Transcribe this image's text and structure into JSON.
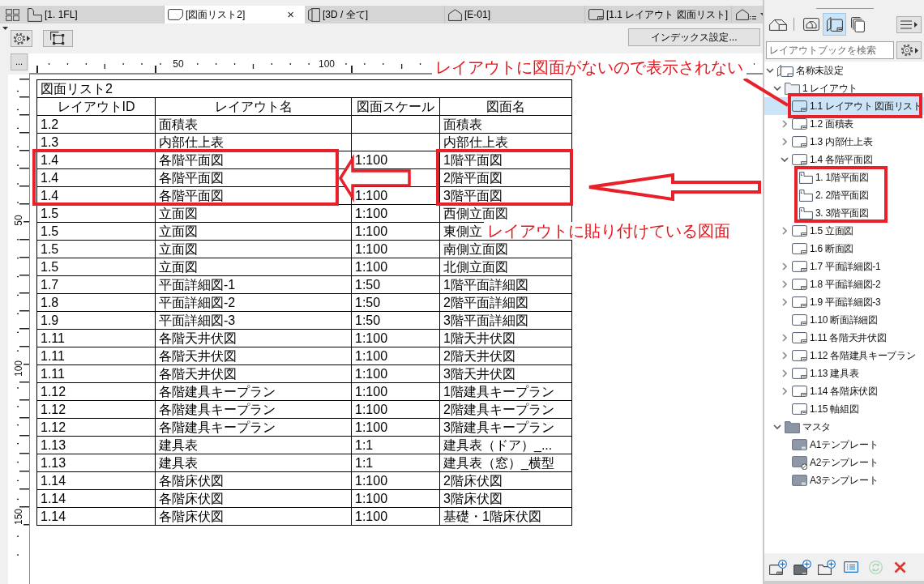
{
  "tab_bar": {
    "tabs": [
      {
        "kind": "plan",
        "label": "[1. 1FL]",
        "selected": false
      },
      {
        "kind": "layout",
        "label": "[図面リスト2]",
        "selected": true,
        "close": "×"
      },
      {
        "kind": "model",
        "label": "[3D / 全て]",
        "selected": false
      },
      {
        "kind": "elevation",
        "label": "[E-01]",
        "selected": false
      },
      {
        "kind": "sheet",
        "label": "[1.1 レイアウト 図面リスト]",
        "selected": false
      }
    ]
  },
  "toolbar": {
    "index_settings_button": "インデックス設定..."
  },
  "ruler": {
    "more_button": "...",
    "horizontal_labels": [
      "50",
      "100"
    ],
    "vertical_labels": [
      "50",
      "100",
      "150"
    ]
  },
  "table": {
    "title": "図面リスト2",
    "columns": [
      "レイアウトID",
      "レイアウト名",
      "図面スケール",
      "図面名"
    ],
    "rows": [
      {
        "layout_id": "1.2",
        "layout_name": "面積表",
        "drawing_name": "面積表"
      },
      {
        "layout_id": "1.3",
        "layout_name": "内部仕上表",
        "drawing_name": "内部仕上表"
      },
      {
        "layout_id": "1.4",
        "layout_name": "各階平面図",
        "drawing_scale": "1:100",
        "drawing_name": "1階平面図"
      },
      {
        "layout_id": "1.4",
        "layout_name": "各階平面図",
        "drawing_name": "2階平面図"
      },
      {
        "layout_id": "1.4",
        "layout_name": "各階平面図",
        "drawing_scale": "1:100",
        "drawing_name": "3階平面図"
      },
      {
        "layout_id": "1.5",
        "layout_name": "立面図",
        "drawing_scale": "1:100",
        "drawing_name": "西側立面図"
      },
      {
        "layout_id": "1.5",
        "layout_name": "立面図",
        "drawing_scale": "1:100",
        "drawing_name": "東側立"
      },
      {
        "layout_id": "1.5",
        "layout_name": "立面図",
        "drawing_scale": "1:100",
        "drawing_name": "南側立面図"
      },
      {
        "layout_id": "1.5",
        "layout_name": "立面図",
        "drawing_scale": "1:100",
        "drawing_name": "北側立面図"
      },
      {
        "layout_id": "1.7",
        "layout_name": "平面詳細図-1",
        "drawing_scale": "1:50",
        "drawing_name": "1階平面詳細図"
      },
      {
        "layout_id": "1.8",
        "layout_name": "平面詳細図-2",
        "drawing_scale": "1:50",
        "drawing_name": "2階平面詳細図"
      },
      {
        "layout_id": "1.9",
        "layout_name": "平面詳細図-3",
        "drawing_scale": "1:50",
        "drawing_name": "3階平面詳細図"
      },
      {
        "layout_id": "1.11",
        "layout_name": "各階天井伏図",
        "drawing_scale": "1:100",
        "drawing_name": "1階天井伏図"
      },
      {
        "layout_id": "1.11",
        "layout_name": "各階天井伏図",
        "drawing_scale": "1:100",
        "drawing_name": "2階天井伏図"
      },
      {
        "layout_id": "1.11",
        "layout_name": "各階天井伏図",
        "drawing_scale": "1:100",
        "drawing_name": "3階天井伏図"
      },
      {
        "layout_id": "1.12",
        "layout_name": "各階建具キープラン",
        "drawing_scale": "1:100",
        "drawing_name": "1階建具キープラン"
      },
      {
        "layout_id": "1.12",
        "layout_name": "各階建具キープラン",
        "drawing_scale": "1:100",
        "drawing_name": "2階建具キープラン"
      },
      {
        "layout_id": "1.12",
        "layout_name": "各階建具キープラン",
        "drawing_scale": "1:100",
        "drawing_name": "3階建具キープラン"
      },
      {
        "layout_id": "1.13",
        "layout_name": "建具表",
        "drawing_scale": "1:1",
        "drawing_name": "建具表（ドア）_..."
      },
      {
        "layout_id": "1.13",
        "layout_name": "建具表",
        "drawing_scale": "1:1",
        "drawing_name": "建具表（窓）_横型"
      },
      {
        "layout_id": "1.14",
        "layout_name": "各階床伏図",
        "drawing_scale": "1:100",
        "drawing_name": "2階床伏図"
      },
      {
        "layout_id": "1.14",
        "layout_name": "各階床伏図",
        "drawing_scale": "1:100",
        "drawing_name": "3階床伏図"
      },
      {
        "layout_id": "1.14",
        "layout_name": "各階床伏図",
        "drawing_scale": "1:100",
        "drawing_name": "基礎・1階床伏図"
      }
    ]
  },
  "annotations": [
    {
      "text": "レイアウトに図面がないので表示されない"
    },
    {
      "text": "レイアウトに貼り付けている図面"
    }
  ],
  "layout_book": {
    "modes": [
      {
        "kind": "project",
        "selected": false
      },
      {
        "kind": "view",
        "selected": false
      },
      {
        "kind": "layout",
        "selected": true
      },
      {
        "kind": "publisher",
        "selected": false
      }
    ],
    "search": {
      "placeholder": "レイアウトブックを検索"
    },
    "tree": [
      {
        "kind": "book",
        "label": "名称未設定",
        "expanded": true,
        "selected": false,
        "children": [
          {
            "kind": "folder",
            "label": "1 レイアウト",
            "expanded": true,
            "selected": false,
            "children": [
              {
                "kind": "layout",
                "label": "1.1 レイアウト 図面リスト",
                "selected": true
              },
              {
                "kind": "layout",
                "label": "1.2 面積表",
                "expanded": false,
                "selected": false
              },
              {
                "kind": "layout",
                "label": "1.3 内部仕上表",
                "expanded": false,
                "selected": false
              },
              {
                "kind": "layout",
                "label": "1.4 各階平面図",
                "expanded": true,
                "selected": false,
                "children": [
                  {
                    "kind": "drawing",
                    "label": "1. 1階平面図",
                    "selected": false
                  },
                  {
                    "kind": "drawing",
                    "label": "2. 2階平面図",
                    "selected": false
                  },
                  {
                    "kind": "drawing",
                    "label": "3. 3階平面図",
                    "selected": false
                  }
                ]
              },
              {
                "kind": "layout",
                "label": "1.5 立面図",
                "expanded": false,
                "selected": false
              },
              {
                "kind": "layout",
                "label": "1.6 断面図",
                "selected": false
              },
              {
                "kind": "layout",
                "label": "1.7 平面詳細図-1",
                "expanded": false,
                "selected": false
              },
              {
                "kind": "layout",
                "label": "1.8 平面詳細図-2",
                "expanded": false,
                "selected": false
              },
              {
                "kind": "layout",
                "label": "1.9 平面詳細図-3",
                "expanded": false,
                "selected": false
              },
              {
                "kind": "layout",
                "label": "1.10 断面詳細図",
                "selected": false
              },
              {
                "kind": "layout",
                "label": "1.11 各階天井伏図",
                "expanded": false,
                "selected": false
              },
              {
                "kind": "layout",
                "label": "1.12 各階建具キープラン",
                "expanded": false,
                "selected": false
              },
              {
                "kind": "layout",
                "label": "1.13 建具表",
                "expanded": false,
                "selected": false
              },
              {
                "kind": "layout",
                "label": "1.14 各階床伏図",
                "expanded": false,
                "selected": false
              },
              {
                "kind": "layout",
                "label": "1.15 軸組図",
                "selected": false
              }
            ]
          },
          {
            "kind": "master_folder",
            "label": "マスタ",
            "expanded": true,
            "selected": false,
            "children": [
              {
                "kind": "master",
                "label": "A1テンプレート",
                "selected": false,
                "marked": false
              },
              {
                "kind": "master",
                "label": "A2テンプレート",
                "selected": false,
                "marked": true
              },
              {
                "kind": "master",
                "label": "A3テンプレート",
                "selected": false,
                "marked": false
              }
            ]
          }
        ]
      }
    ],
    "tools": [
      {
        "kind": "new_layout",
        "disabled": false
      },
      {
        "kind": "new_master",
        "disabled": false
      },
      {
        "kind": "new_folder",
        "disabled": false
      },
      {
        "kind": "properties",
        "disabled": false
      },
      {
        "kind": "update",
        "disabled": true
      },
      {
        "kind": "delete",
        "disabled": false
      }
    ]
  }
}
